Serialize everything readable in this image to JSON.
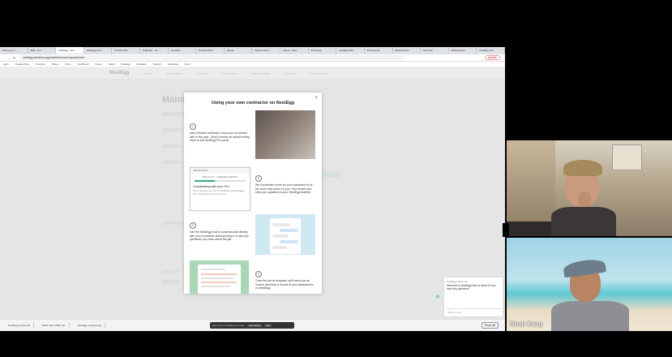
{
  "browser": {
    "tabs": [
      "Using your c",
      "Mail - son",
      "NestEgg - Hoa",
      "NestEgg Hom",
      "Product Sho",
      "Calendar - Ho",
      "Zendesk",
      "Product Plan",
      "Figma",
      "Figma Comm",
      "Figma - Nest",
      "Prototype",
      "NestEgg Mar",
      "Prototyping",
      "Maintenance",
      "New Tab",
      "Maintenance",
      "NestEgg Con"
    ],
    "active_tab": 2,
    "url": "nestegg.sandbox.app/maintenance/requests/new",
    "update_label": "Update",
    "bookmarks": [
      "Apps",
      "Google Drive",
      "Dropbox",
      "Notion",
      "Inbox",
      "Jira Board",
      "Figma",
      "Slack",
      "NestEgg",
      "Analytics",
      "Support",
      "Roadmap",
      "Docs"
    ]
  },
  "app": {
    "logo": "NestEgg",
    "nav": [
      "Home",
      "Properties",
      "Tenants",
      "Payments",
      "Maintenance",
      "Reports",
      "Documents"
    ],
    "page_title": "Maintenance"
  },
  "modal": {
    "title": "Using your own contractor on NestEgg",
    "close": "×",
    "steps": [
      {
        "num": "1",
        "text": "Add a trusted contractor whom you've worked with in the past. They'll receive an email inviting them to the NestEgg Pro portal."
      },
      {
        "num": "2",
        "text": "We'll schedule a time for your contractor to fix the issue that works for you. Your tenant and keep you updated on your NestEgg timeline."
      },
      {
        "num": "3",
        "text": "Use the NestEgg chat to communicate directly with your contractor about pricing or to ask any questions you have about the job."
      },
      {
        "num": "4",
        "text": "Once the job is complete, we'll send you an invoice and keep a record of your transactions on NestEgg."
      }
    ],
    "card": {
      "header": "NEW REQUEST",
      "step": "Step 2 of 3 · scheduling with Pro",
      "progress": 0.4,
      "title": "Coordinating with your Pro",
      "subtitle": "We're updating your Pro's availability with NestEgg and confirming times and access."
    }
  },
  "downloads": {
    "items": [
      "NestEgg Invoice.pdf",
      "NEST-docs-2021.xlsx",
      "NestEgg-mockups.jpg"
    ],
    "show_all": "Show all"
  },
  "sharebar": {
    "text": "app.zoom.us is sharing your screen.",
    "stop": "Stop sharing",
    "hide": "Hide"
  },
  "chat_widget": {
    "title": "NestEgg Online Inc",
    "message": "Welcome to NestEgg! Ask us about it if you have any questions.",
    "placeholder": "Write a reply..."
  },
  "video": {
    "participant2_name": "Noah Kang"
  }
}
